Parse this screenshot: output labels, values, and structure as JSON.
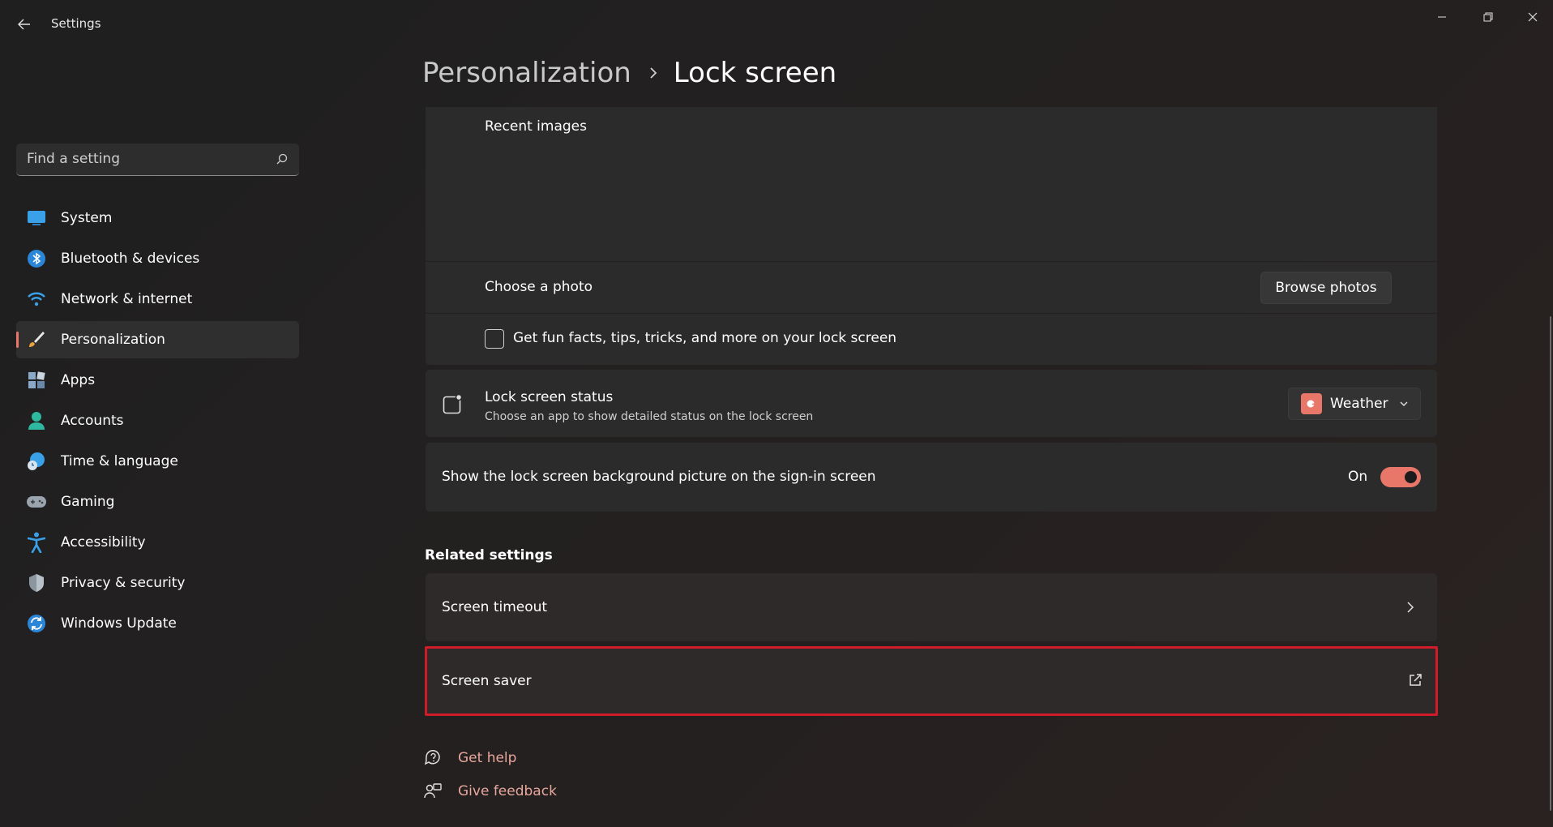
{
  "window": {
    "title": "Settings"
  },
  "search": {
    "placeholder": "Find a setting"
  },
  "sidebar": {
    "items": [
      {
        "label": "System",
        "icon": "monitor-icon"
      },
      {
        "label": "Bluetooth & devices",
        "icon": "bluetooth-icon"
      },
      {
        "label": "Network & internet",
        "icon": "wifi-icon"
      },
      {
        "label": "Personalization",
        "icon": "brush-icon",
        "active": true
      },
      {
        "label": "Apps",
        "icon": "apps-icon"
      },
      {
        "label": "Accounts",
        "icon": "person-icon"
      },
      {
        "label": "Time & language",
        "icon": "globe-clock-icon"
      },
      {
        "label": "Gaming",
        "icon": "gamepad-icon"
      },
      {
        "label": "Accessibility",
        "icon": "accessibility-icon"
      },
      {
        "label": "Privacy & security",
        "icon": "shield-icon"
      },
      {
        "label": "Windows Update",
        "icon": "update-icon"
      }
    ]
  },
  "breadcrumb": {
    "parent": "Personalization",
    "current": "Lock screen"
  },
  "lock_screen": {
    "recent_images_label": "Recent images",
    "choose_photo_label": "Choose a photo",
    "browse_button": "Browse photos",
    "fun_facts_label": "Get fun facts, tips, tricks, and more on your lock screen",
    "fun_facts_checked": false,
    "status_title": "Lock screen status",
    "status_description": "Choose an app to show detailed status on the lock screen",
    "status_app": "Weather",
    "signin_label": "Show the lock screen background picture on the sign-in screen",
    "signin_state": "On",
    "signin_on": true
  },
  "related": {
    "title": "Related settings",
    "items": [
      {
        "label": "Screen timeout",
        "icon": "chevron-right-icon"
      },
      {
        "label": "Screen saver",
        "icon": "open-external-icon"
      }
    ]
  },
  "help": {
    "get_help": "Get help",
    "give_feedback": "Give feedback"
  },
  "colors": {
    "accent": "#e8776a",
    "highlight": "#d01c2a",
    "link": "#e8a79d"
  }
}
